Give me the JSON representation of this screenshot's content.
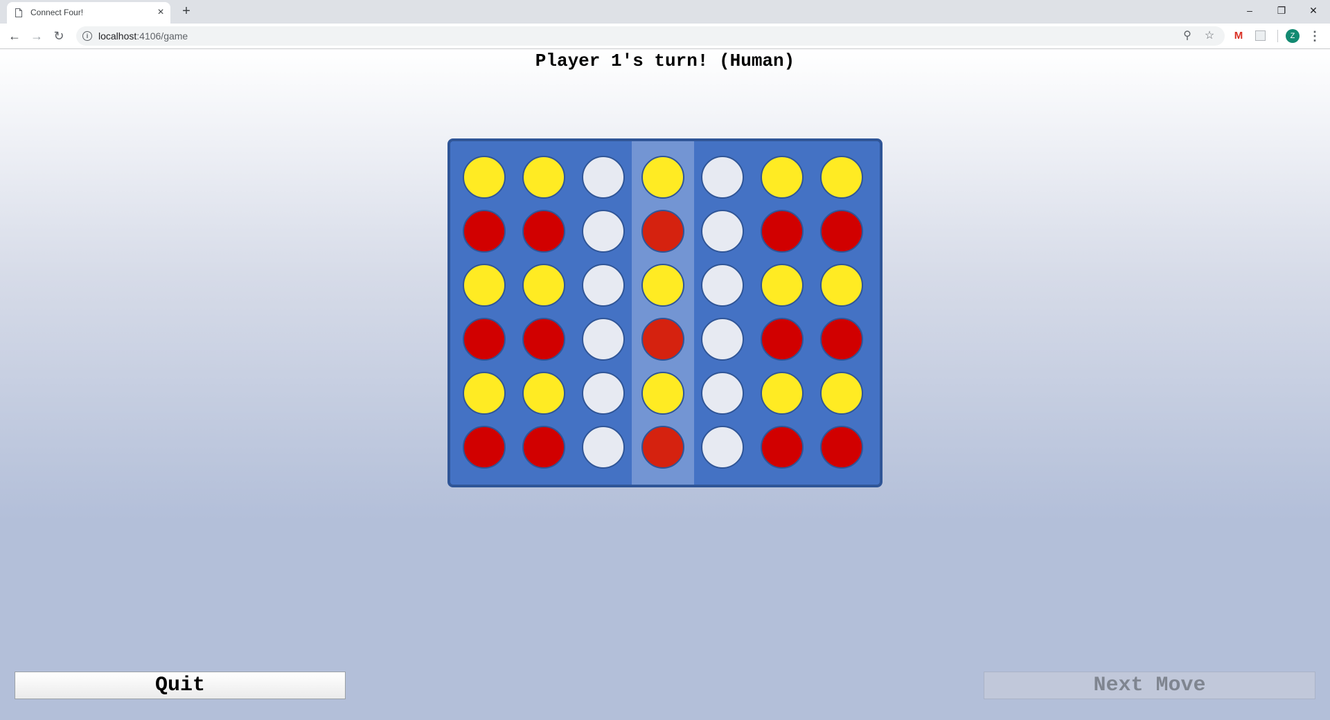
{
  "browser": {
    "tab_title": "Connect Four!",
    "tab_close": "×",
    "new_tab": "+",
    "url_host": "localhost",
    "url_path": ":4106/game",
    "profile_initial": "Z",
    "window_controls": {
      "minimize": "–",
      "maximize": "❐",
      "close": "✕"
    }
  },
  "game": {
    "turn_text": "Player 1's turn! (Human)",
    "highlighted_column": 3,
    "rows": [
      [
        "yellow",
        "yellow",
        "empty",
        "yellow",
        "empty",
        "yellow",
        "yellow"
      ],
      [
        "red",
        "red",
        "empty",
        "red",
        "empty",
        "red",
        "red"
      ],
      [
        "yellow",
        "yellow",
        "empty",
        "yellow",
        "empty",
        "yellow",
        "yellow"
      ],
      [
        "red",
        "red",
        "empty",
        "red",
        "empty",
        "red",
        "red"
      ],
      [
        "yellow",
        "yellow",
        "empty",
        "yellow",
        "empty",
        "yellow",
        "yellow"
      ],
      [
        "red",
        "red",
        "empty",
        "red",
        "empty",
        "red",
        "red"
      ]
    ],
    "colors": {
      "board": "#4472c4",
      "board_border": "#2f5597",
      "red": "#d10000",
      "yellow": "#ffeb23",
      "empty": "#e7eaf2"
    }
  },
  "controls": {
    "quit_label": "Quit",
    "next_move_label": "Next Move",
    "next_move_enabled": false
  }
}
